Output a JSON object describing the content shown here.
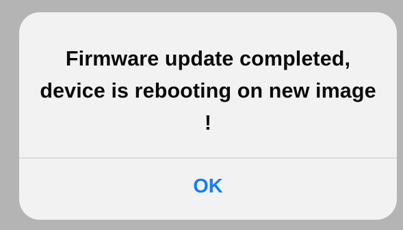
{
  "alert": {
    "message": "Firmware update completed, device is rebooting on new image !",
    "ok_label": "OK",
    "colors": {
      "backdrop": "#b4b4b4",
      "dialog_background": "#f2f2f2",
      "message_text": "#0a0a0a",
      "divider": "#c6c6c8",
      "button_text": "#1a7cf5"
    }
  }
}
